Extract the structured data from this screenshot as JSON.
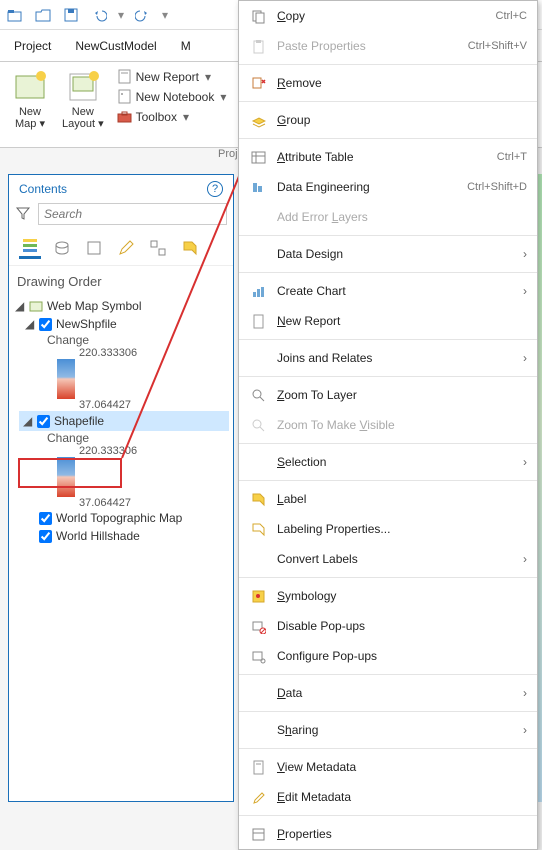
{
  "toolbar_icons": [
    "open-icon",
    "open-folder-icon",
    "save-icon",
    "undo-icon",
    "redo-icon",
    "more-icon"
  ],
  "tabs": {
    "project": "Project",
    "model": "NewCustModel",
    "extra": "M"
  },
  "ribbon": {
    "new_map": "New\nMap",
    "new_layout": "New\nLayout",
    "new_report": "New Report",
    "new_notebook": "New Notebook",
    "toolbox": "Toolbox",
    "proj_label": "Proj"
  },
  "contents": {
    "title": "Contents",
    "search_placeholder": "Search",
    "drawing_order": "Drawing Order",
    "map_frame": "Web Map Symbol",
    "layer1": "NewShpfile",
    "change": "Change",
    "ramp_top": "220.333306",
    "ramp_bottom": "37.064427",
    "layer2": "Shapefile",
    "layer3": "World Topographic Map",
    "layer4": "World Hillshade"
  },
  "menu": {
    "copy": "Copy",
    "copy_sc": "Ctrl+C",
    "paste": "Paste Properties",
    "paste_sc": "Ctrl+Shift+V",
    "remove": "Remove",
    "group": "Group",
    "attr": "Attribute Table",
    "attr_sc": "Ctrl+T",
    "dataeng": "Data Engineering",
    "dataeng_sc": "Ctrl+Shift+D",
    "adderr": "Add Error Layers",
    "design": "Data Design",
    "chart": "Create Chart",
    "report": "New Report",
    "joins": "Joins and Relates",
    "zoomlayer": "Zoom To Layer",
    "zoomvis": "Zoom To Make Visible",
    "selection": "Selection",
    "label": "Label",
    "labelprops": "Labeling Properties...",
    "convlabels": "Convert Labels",
    "symbology": "Symbology",
    "disablepop": "Disable Pop-ups",
    "configpop": "Configure Pop-ups",
    "data": "Data",
    "sharing": "Sharing",
    "viewmeta": "View Metadata",
    "editmeta": "Edit Metadata",
    "properties": "Properties"
  }
}
